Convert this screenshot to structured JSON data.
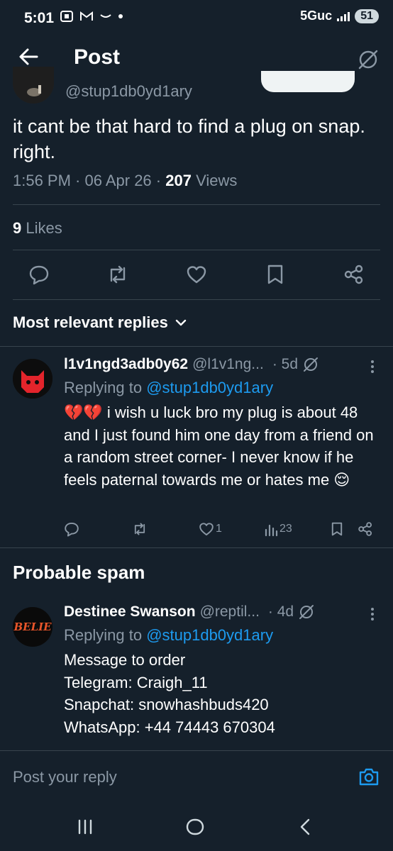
{
  "status_bar": {
    "time": "5:01",
    "network": "5Guc",
    "battery": "51"
  },
  "header": {
    "title": "Post"
  },
  "post": {
    "handle": "@stup1db0yd1ary",
    "text": "it cant be that hard to find a plug on snap.  right.",
    "time_date": "1:56 PM · 06 Apr 26 · ",
    "views_count": "207",
    "views_label": " Views",
    "likes_count": "9",
    "likes_label": " Likes"
  },
  "sort": {
    "label": "Most relevant replies"
  },
  "replies": [
    {
      "name": "l1v1ngd3adb0y62",
      "handle": "@l1v1ng...",
      "age": "· 5d",
      "replying_prefix": "Replying to ",
      "replying_to": "@stup1db0yd1ary",
      "text": "💔💔 i wish u luck bro my plug is about 48 and I just found him one day from a friend on a random street corner- I never know if he feels paternal towards me or hates me 😌",
      "likes": "1",
      "views": "23"
    },
    {
      "name": "Destinee Swanson",
      "handle": "@reptil...",
      "age": "· 4d",
      "replying_prefix": "Replying to ",
      "replying_to": "@stup1db0yd1ary",
      "lines": [
        "Message to order",
        "Telegram: Craigh_11",
        "Snapchat: snowhashbuds420",
        "WhatsApp: +44 74443 670304"
      ],
      "avatar_text": "BELIE"
    }
  ],
  "spam_section": {
    "title": "Probable spam"
  },
  "reply_input": {
    "placeholder": "Post your reply"
  },
  "colors": {
    "background": "#15202b",
    "divider": "#38444d",
    "muted": "#8b98a5",
    "accent": "#1d9bf0"
  }
}
